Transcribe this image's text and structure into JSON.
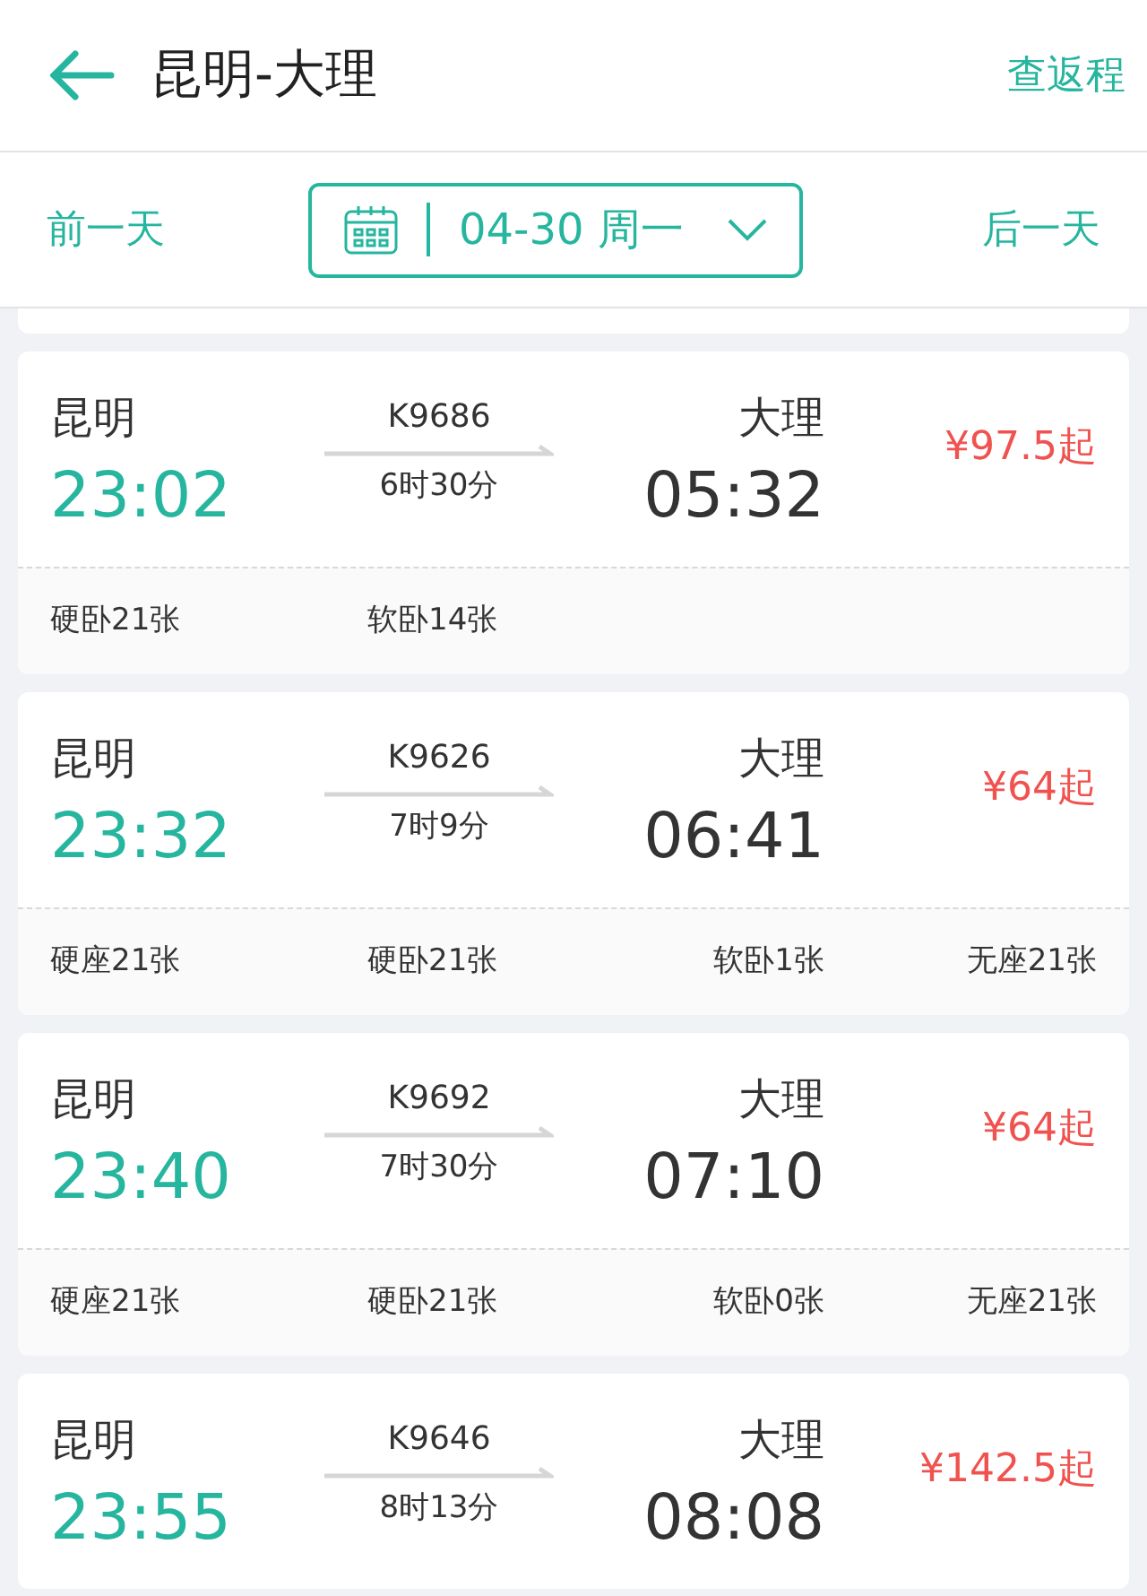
{
  "header": {
    "title": "昆明-大理",
    "return_link": "查返程"
  },
  "date_bar": {
    "prev": "前一天",
    "date": "04-30 周一",
    "next": "后一天"
  },
  "trains": [
    {
      "from": "昆明",
      "depart": "23:02",
      "number": "K9686",
      "duration": "6时30分",
      "to": "大理",
      "arrive": "05:32",
      "price": "¥97.5起",
      "seats": [
        "硬卧21张",
        "软卧14张"
      ]
    },
    {
      "from": "昆明",
      "depart": "23:32",
      "number": "K9626",
      "duration": "7时9分",
      "to": "大理",
      "arrive": "06:41",
      "price": "¥64起",
      "seats": [
        "硬座21张",
        "硬卧21张",
        "软卧1张",
        "无座21张"
      ]
    },
    {
      "from": "昆明",
      "depart": "23:40",
      "number": "K9692",
      "duration": "7时30分",
      "to": "大理",
      "arrive": "07:10",
      "price": "¥64起",
      "seats": [
        "硬座21张",
        "硬卧21张",
        "软卧0张",
        "无座21张"
      ]
    },
    {
      "from": "昆明",
      "depart": "23:55",
      "number": "K9646",
      "duration": "8时13分",
      "to": "大理",
      "arrive": "08:08",
      "price": "¥142.5起"
    }
  ]
}
